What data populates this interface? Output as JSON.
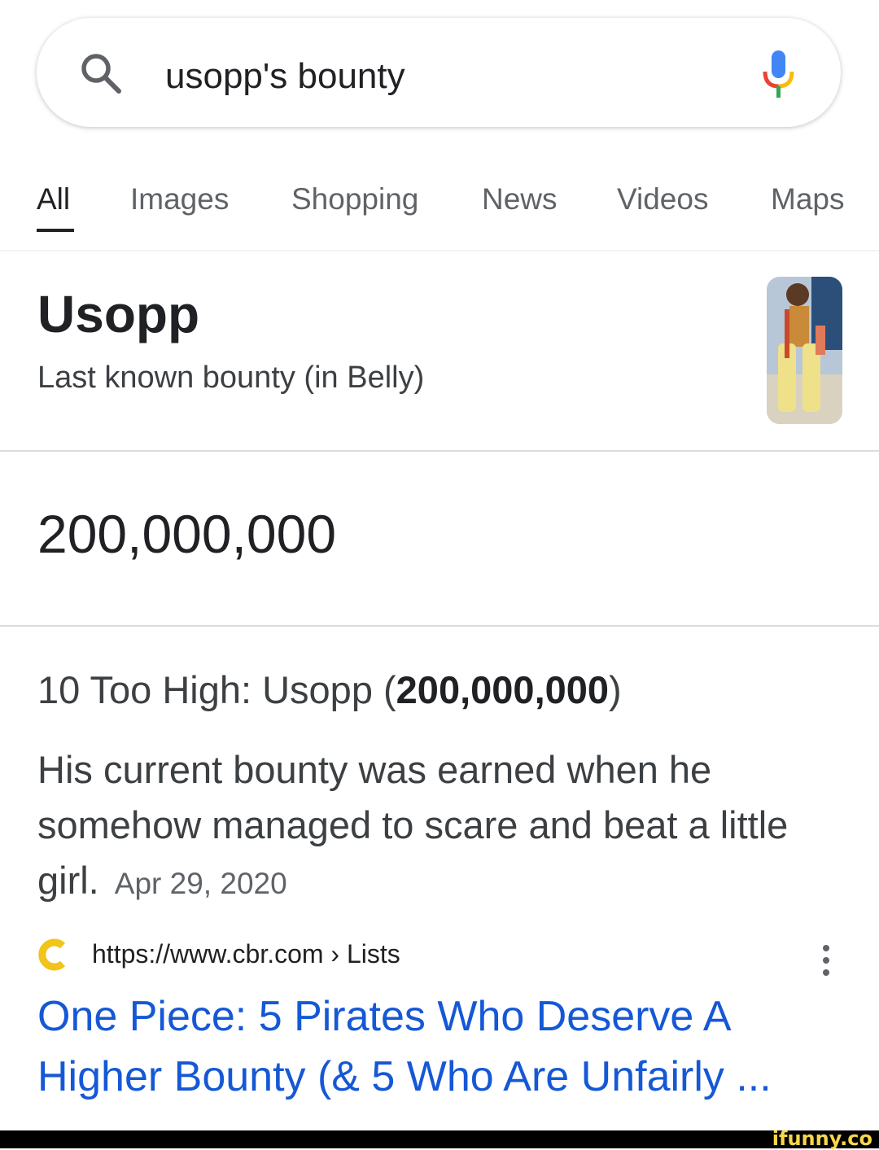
{
  "search": {
    "query": "usopp's bounty"
  },
  "tabs": [
    {
      "label": "All"
    },
    {
      "label": "Images"
    },
    {
      "label": "Shopping"
    },
    {
      "label": "News"
    },
    {
      "label": "Videos"
    },
    {
      "label": "Maps"
    }
  ],
  "knowledge": {
    "title": "Usopp",
    "subtitle": "Last known bounty (in Belly)",
    "value": "200,000,000"
  },
  "snippet": {
    "heading_prefix": "10 Too High: Usopp (",
    "heading_bold": "200,000,000",
    "heading_suffix": ")",
    "body": "His current bounty was earned when he somehow managed to scare and beat a little girl.",
    "date": "Apr 29, 2020"
  },
  "source": {
    "url": "https://www.cbr.com › Lists",
    "title": "One Piece: 5 Pirates Who Deserve A Higher Bounty (& 5 Who Are Unfairly ..."
  },
  "watermark": "ifunny.co",
  "colors": {
    "link": "#1558d6",
    "text": "#202124",
    "secondary": "#5f6368"
  }
}
